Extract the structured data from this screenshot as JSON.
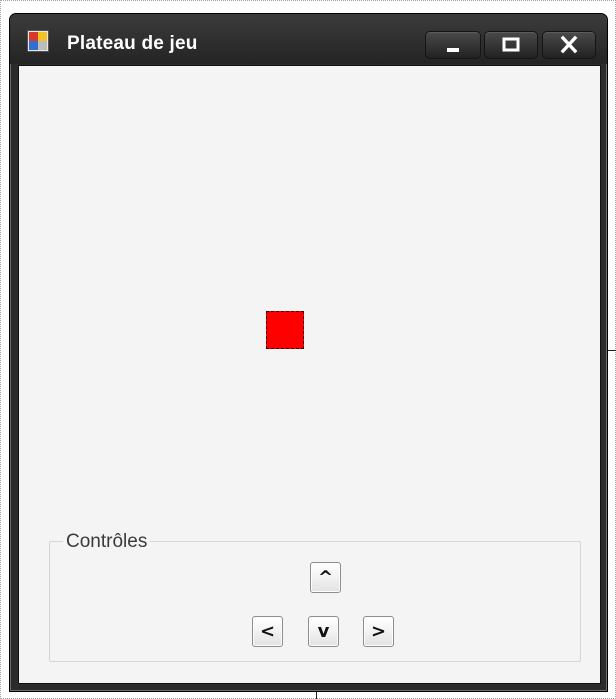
{
  "window": {
    "title": "Plateau de jeu"
  },
  "controls": {
    "group_label": "Contrôles",
    "up_label": "^",
    "left_label": "<",
    "down_label": "v",
    "right_label": ">"
  },
  "icons": {
    "app": "form-app-icon",
    "minimize": "minimize-icon",
    "maximize": "maximize-icon",
    "close": "close-icon"
  },
  "colors": {
    "player": "#ff0000",
    "client_background": "#f4f4f4",
    "titlebar": "#2b2b2b"
  }
}
